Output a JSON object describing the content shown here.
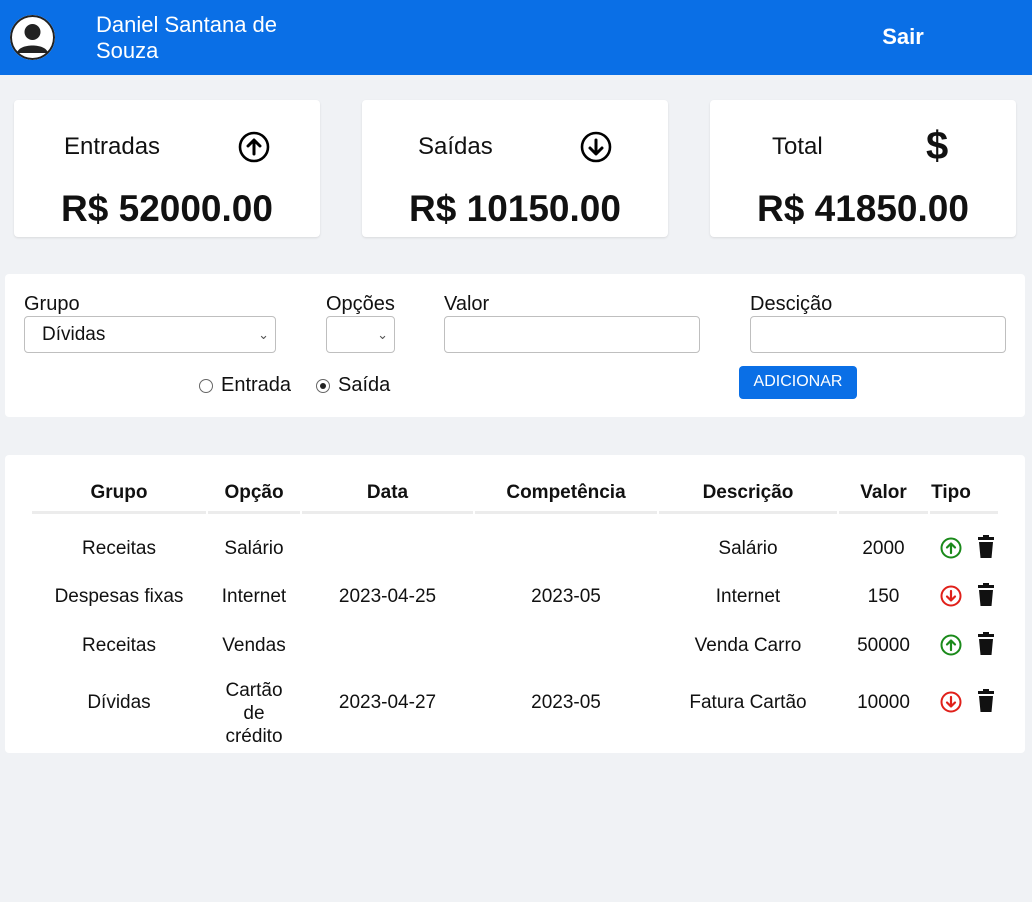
{
  "header": {
    "user_name": "Daniel Santana de Souza",
    "logout_label": "Sair"
  },
  "summary": {
    "income": {
      "label": "Entradas",
      "value": "R$ 52000.00",
      "icon": "arrow-up-circle-icon"
    },
    "expenses": {
      "label": "Saídas",
      "value": "R$ 10150.00",
      "icon": "arrow-down-circle-icon"
    },
    "total": {
      "label": "Total",
      "value": "R$ 41850.00",
      "icon": "dollar-icon"
    }
  },
  "form": {
    "group_label": "Grupo",
    "group_value": "Dívidas",
    "options_label": "Opções",
    "options_value": "",
    "value_label": "Valor",
    "value_input": "",
    "description_label": "Descição",
    "description_input": "",
    "radio_income": "Entrada",
    "radio_expense": "Saída",
    "selected_type": "Saída",
    "add_button": "ADICIONAR"
  },
  "table": {
    "headers": [
      "Grupo",
      "Opção",
      "Data",
      "Competência",
      "Descrição",
      "Valor",
      "Tipo"
    ],
    "rows": [
      {
        "group": "Receitas",
        "option": "Salário",
        "date": "",
        "competence": "",
        "description": "Salário",
        "value": "2000",
        "type": "entrada"
      },
      {
        "group": "Despesas fixas",
        "option": "Internet",
        "date": "2023-04-25",
        "competence": "2023-05",
        "description": "Internet",
        "value": "150",
        "type": "saida"
      },
      {
        "group": "Receitas",
        "option": "Vendas",
        "date": "",
        "competence": "",
        "description": "Venda Carro",
        "value": "50000",
        "type": "entrada"
      },
      {
        "group": "Dívidas",
        "option": "Cartão de crédito",
        "date": "2023-04-27",
        "competence": "2023-05",
        "description": "Fatura Cartão",
        "value": "10000",
        "type": "saida"
      }
    ]
  },
  "colors": {
    "primary": "#0a6fe6",
    "income_icon": "#1a8a1a",
    "expense_icon": "#e0201a",
    "background": "#f0f2f5"
  }
}
